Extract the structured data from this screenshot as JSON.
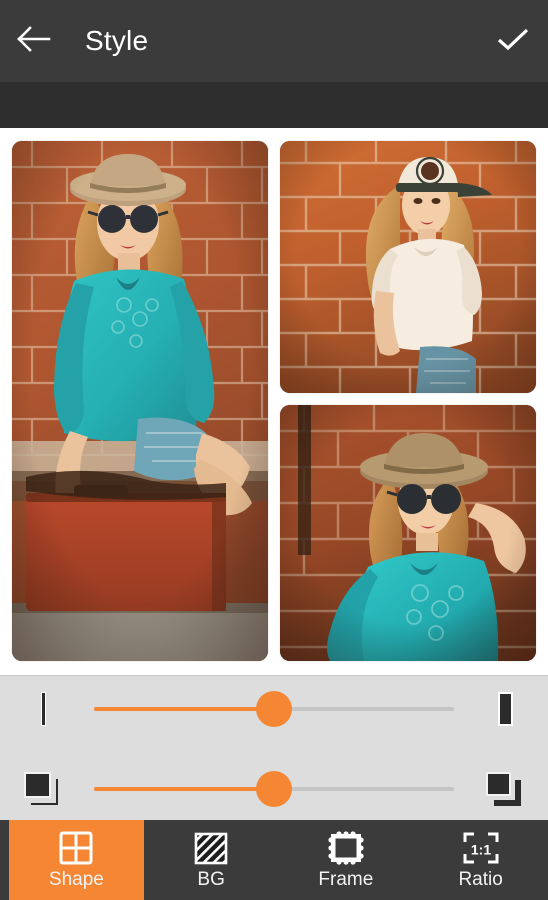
{
  "appbar": {
    "back_icon": "arrow-left-icon",
    "title": "Style",
    "done_icon": "checkmark-icon"
  },
  "colors": {
    "accent": "#f58634",
    "appbar_bg": "#3b3b3b",
    "subbar_bg": "#2e2e2e",
    "panel_bg": "#dddddd",
    "track_bg": "#c4c4c4",
    "text_light": "#ffffff"
  },
  "collage": {
    "cells": [
      {
        "name": "photo-cell-left",
        "alt": "Woman in fedora hat and sunglasses wearing teal tunic sitting on red suitcase by brick wall"
      },
      {
        "name": "photo-cell-top-right",
        "alt": "Woman in white cap and white t-shirt leaning against orange brick wall"
      },
      {
        "name": "photo-cell-bottom-right",
        "alt": "Woman in straw hat and sunglasses in teal tunic with arm raised by brick wall"
      }
    ]
  },
  "sliders": [
    {
      "name": "border-width-slider",
      "left_icon": "thin-border-icon",
      "right_icon": "thick-border-icon",
      "value": 50
    },
    {
      "name": "corner-radius-slider",
      "left_icon": "small-radius-icon",
      "right_icon": "large-radius-icon",
      "value": 50
    }
  ],
  "tabbar": {
    "items": [
      {
        "label": "Shape",
        "icon": "grid-shape-icon",
        "active": true
      },
      {
        "label": "BG",
        "icon": "hatched-square-icon",
        "active": false
      },
      {
        "label": "Frame",
        "icon": "stamp-frame-icon",
        "active": false
      },
      {
        "label": "Ratio",
        "icon": "aspect-ratio-icon",
        "ratio_text": "1:1",
        "active": false
      }
    ]
  }
}
